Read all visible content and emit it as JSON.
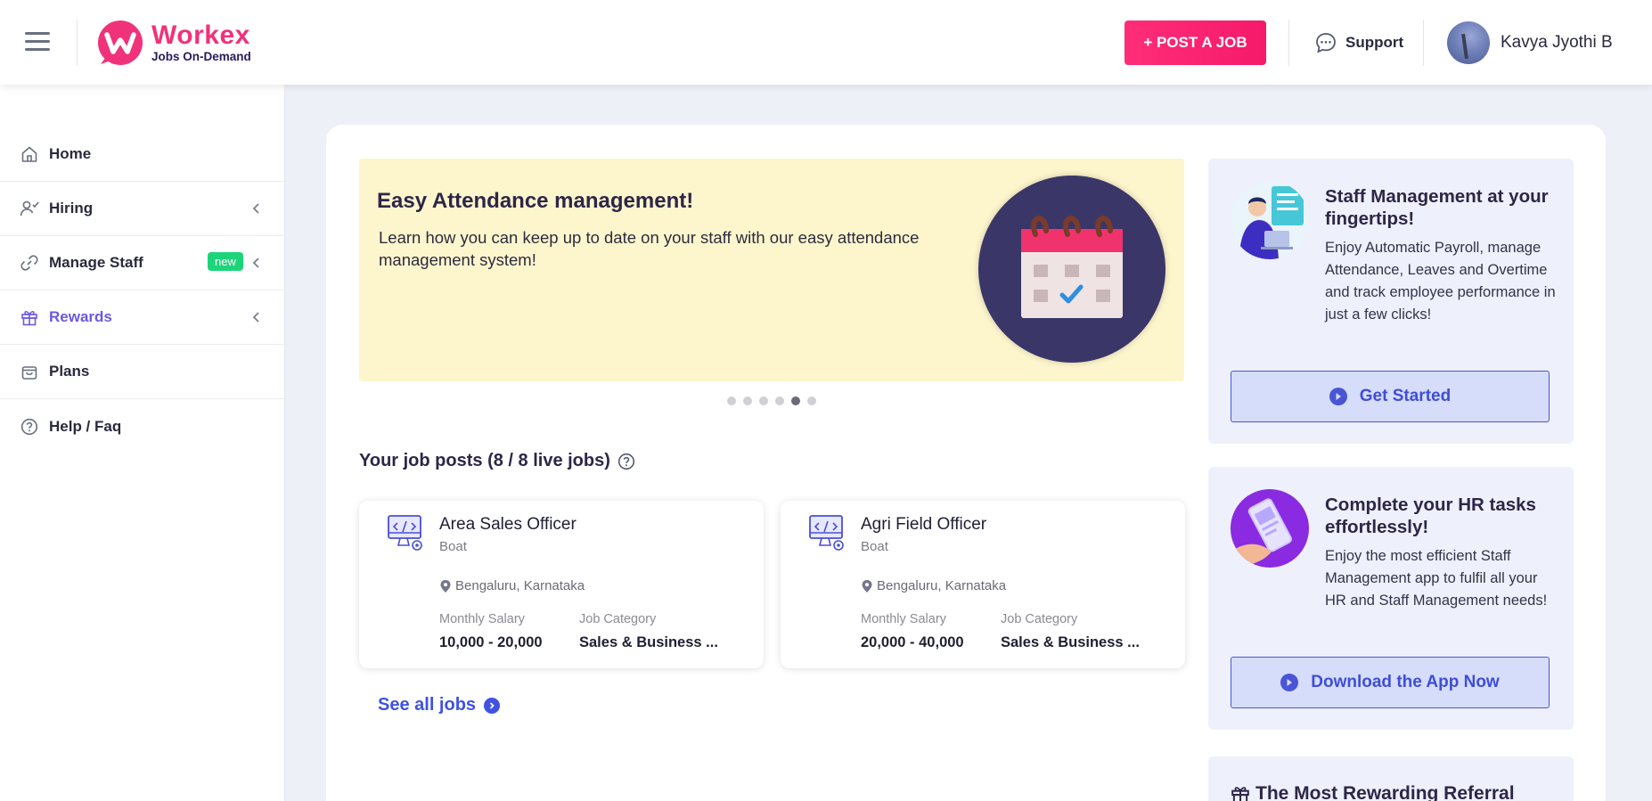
{
  "header": {
    "brand_name": "Workex",
    "brand_tagline": "Jobs On-Demand",
    "post_job_label": "+ POST A JOB",
    "support_label": "Support",
    "user_name": "Kavya Jyothi B"
  },
  "sidebar": {
    "items": [
      {
        "label": "Home",
        "icon": "home-icon",
        "chevron": false
      },
      {
        "label": "Hiring",
        "icon": "hiring-icon",
        "chevron": true
      },
      {
        "label": "Manage Staff",
        "icon": "link-icon",
        "chevron": true,
        "badge": "new"
      },
      {
        "label": "Rewards",
        "icon": "gift-icon",
        "chevron": true,
        "active": true
      },
      {
        "label": "Plans",
        "icon": "bag-icon",
        "chevron": false
      },
      {
        "label": "Help / Faq",
        "icon": "help-icon",
        "chevron": false
      }
    ]
  },
  "banner": {
    "title": "Easy Attendance management!",
    "description": "Learn how you can keep up to date on your staff with our easy attendance management system!",
    "dots_total": 6,
    "dot_active_index": 4
  },
  "jobs": {
    "section_title": "Your job posts (8 / 8 live jobs)",
    "cards": [
      {
        "title": "Area Sales Officer",
        "company": "Boat",
        "location": "Bengaluru, Karnataka",
        "salary_label": "Monthly Salary",
        "salary": "10,000 - 20,000",
        "category_label": "Job Category",
        "category": "Sales & Business ..."
      },
      {
        "title": "Agri Field Officer",
        "company": "Boat",
        "location": "Bengaluru, Karnataka",
        "salary_label": "Monthly Salary",
        "salary": "20,000 - 40,000",
        "category_label": "Job Category",
        "category": "Sales & Business ..."
      }
    ],
    "see_all_label": "See all jobs"
  },
  "promos": [
    {
      "title": "Staff Management at your fingertips!",
      "description": "Enjoy Automatic Payroll, manage Attendance, Leaves and Overtime and track employee performance in just a few clicks!",
      "button": "Get Started"
    },
    {
      "title": "Complete your HR tasks effortlessly!",
      "description": "Enjoy the most efficient Staff Management app to fulfil all your HR and Staff Management needs!",
      "button": "Download the App Now"
    },
    {
      "title": "The Most Rewarding Referral"
    }
  ],
  "colors": {
    "brand_pink": "#f0327a",
    "accent_purple": "#6a5ae0",
    "link_blue": "#3f52e3",
    "banner_yellow": "#fdf6cd",
    "badge_green": "#1ed47a"
  }
}
